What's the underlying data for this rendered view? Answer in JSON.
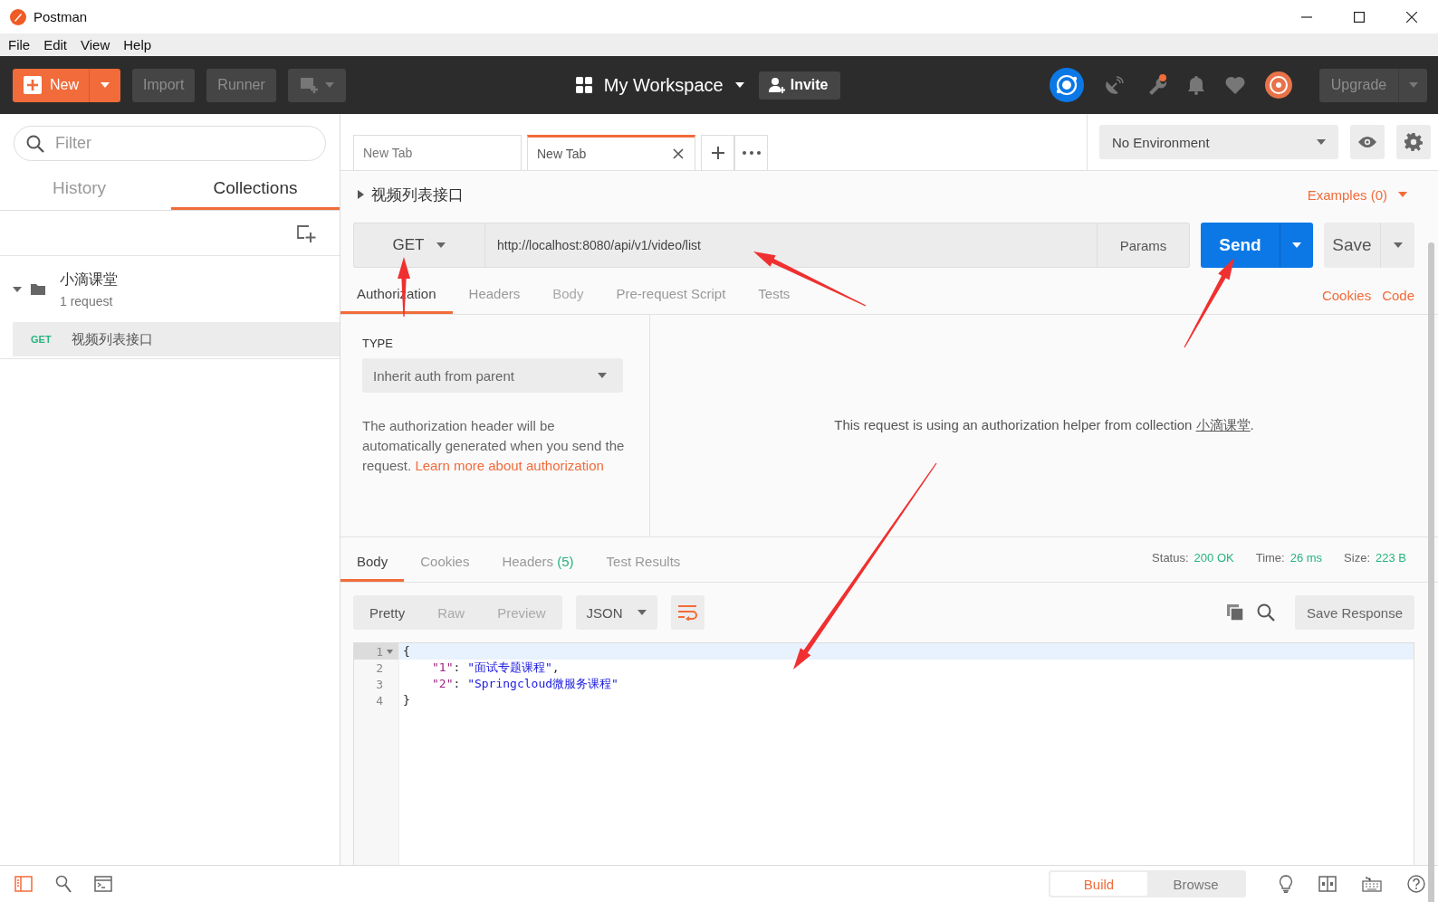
{
  "window": {
    "title": "Postman"
  },
  "menu": [
    "File",
    "Edit",
    "View",
    "Help"
  ],
  "header": {
    "new_label": "New",
    "import_label": "Import",
    "runner_label": "Runner",
    "workspace": "My Workspace",
    "invite_label": "Invite",
    "upgrade_label": "Upgrade"
  },
  "sidebar": {
    "filter_placeholder": "Filter",
    "tabs": [
      {
        "label": "History",
        "selected": false
      },
      {
        "label": "Collections",
        "selected": true
      }
    ],
    "collections": [
      {
        "name": "小滴课堂",
        "subtitle": "1 request",
        "expanded": true,
        "children": [
          {
            "method": "GET",
            "name": "视频列表接口",
            "selected": true
          }
        ]
      }
    ]
  },
  "tabs": [
    {
      "label": "New Tab",
      "selected": false
    },
    {
      "label": "New Tab",
      "selected": true
    }
  ],
  "environment": {
    "value": "No Environment"
  },
  "request": {
    "name": "视频列表接口",
    "examples": "Examples (0)",
    "method": "GET",
    "url": "http://localhost:8080/api/v1/video/list",
    "params_label": "Params",
    "send_label": "Send",
    "save_label": "Save",
    "tabs": [
      {
        "label": "Authorization",
        "selected": true,
        "disabled": false
      },
      {
        "label": "Headers",
        "selected": false,
        "disabled": false
      },
      {
        "label": "Body",
        "selected": false,
        "disabled": true
      },
      {
        "label": "Pre-request Script",
        "selected": false,
        "disabled": false
      },
      {
        "label": "Tests",
        "selected": false,
        "disabled": false
      }
    ],
    "links": [
      "Cookies",
      "Code"
    ]
  },
  "auth": {
    "type_label": "TYPE",
    "type_value": "Inherit auth from parent",
    "description": "The authorization header will be automatically generated when you send the request. ",
    "link": "Learn more about authorization",
    "message": "This request is using an authorization helper from collection ",
    "message_link": "小滴课堂",
    "message_end": "."
  },
  "response": {
    "tabs": [
      {
        "label": "Body",
        "selected": true
      },
      {
        "label": "Cookies",
        "selected": false
      },
      {
        "label": "Headers",
        "count": "(5)",
        "selected": false
      },
      {
        "label": "Test Results",
        "selected": false
      }
    ],
    "stats": [
      {
        "label": "Status:",
        "value": "200 OK"
      },
      {
        "label": "Time:",
        "value": "26 ms"
      },
      {
        "label": "Size:",
        "value": "223 B"
      }
    ],
    "views": [
      {
        "label": "Pretty",
        "selected": true
      },
      {
        "label": "Raw",
        "selected": false
      },
      {
        "label": "Preview",
        "selected": false
      }
    ],
    "format": "JSON",
    "save_label": "Save Response",
    "lines": [
      {
        "number": "1",
        "highlighted": true,
        "foldable": true,
        "indented": false,
        "tokens": [
          {
            "kind": "punct",
            "text": "{"
          }
        ]
      },
      {
        "number": "2",
        "highlighted": false,
        "foldable": false,
        "indented": true,
        "tokens": [
          {
            "kind": "key",
            "text": "\"1\""
          },
          {
            "kind": "punct",
            "text": ": "
          },
          {
            "kind": "string",
            "text": "\"面试专题课程\""
          },
          {
            "kind": "punct",
            "text": ","
          }
        ]
      },
      {
        "number": "3",
        "highlighted": false,
        "foldable": false,
        "indented": true,
        "tokens": [
          {
            "kind": "key",
            "text": "\"2\""
          },
          {
            "kind": "punct",
            "text": ": "
          },
          {
            "kind": "string",
            "text": "\"Springcloud微服务课程\""
          }
        ]
      },
      {
        "number": "4",
        "highlighted": false,
        "foldable": false,
        "indented": false,
        "tokens": [
          {
            "kind": "punct",
            "text": "}"
          }
        ]
      }
    ]
  },
  "footer": {
    "modes": [
      {
        "label": "Build",
        "selected": true
      },
      {
        "label": "Browse",
        "selected": false
      }
    ]
  }
}
